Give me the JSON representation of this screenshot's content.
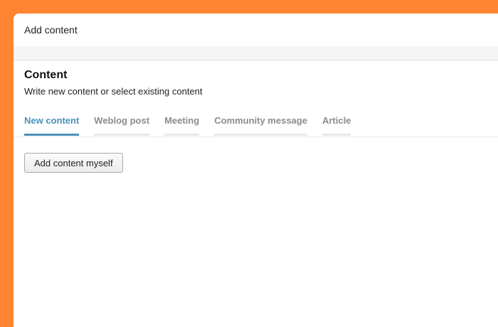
{
  "dialog": {
    "title": "Add content"
  },
  "section": {
    "heading": "Content",
    "description": "Write new content or select existing content"
  },
  "tabs": [
    {
      "label": "New content",
      "active": true
    },
    {
      "label": "Weblog post",
      "active": false
    },
    {
      "label": "Meeting",
      "active": false
    },
    {
      "label": "Community message",
      "active": false
    },
    {
      "label": "Article",
      "active": false
    }
  ],
  "actions": {
    "add_myself_label": "Add content myself"
  },
  "colors": {
    "frame": "#ff8533",
    "active_tab": "#4a90b8",
    "inactive_tab": "#8c8c8c"
  }
}
